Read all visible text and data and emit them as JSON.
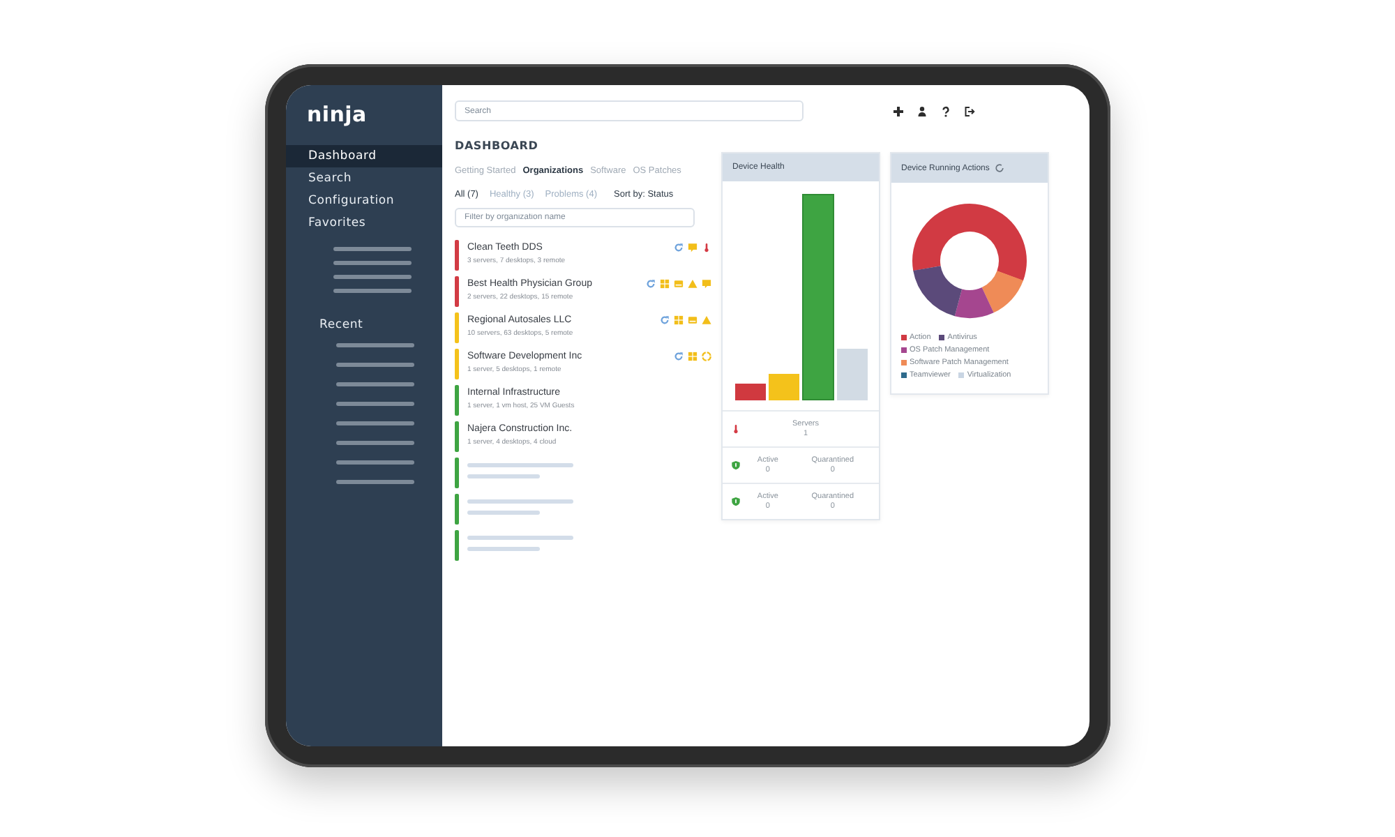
{
  "sidebar": {
    "logo": "ninja",
    "items": [
      {
        "label": "Dashboard",
        "selected": true
      },
      {
        "label": "Search",
        "selected": false
      },
      {
        "label": "Configuration",
        "selected": false
      },
      {
        "label": "Favorites",
        "selected": false
      }
    ],
    "recent_label": "Recent"
  },
  "top_bar": {
    "search": {
      "placeholder": "Search"
    }
  },
  "dashboard": {
    "title": "DASHBOARD",
    "tabs": [
      {
        "label": "Getting Started",
        "selected": false
      },
      {
        "label": "Organizations",
        "selected": true
      },
      {
        "label": "Software",
        "selected": false
      },
      {
        "label": "OS Patches",
        "selected": false
      }
    ],
    "filters": [
      {
        "label": "All (7)",
        "selected": true
      },
      {
        "label": "Healthy (3)",
        "selected": false
      },
      {
        "label": "Problems (4)",
        "selected": false
      }
    ],
    "sort_label": "Sort by: Status",
    "filter_field": {
      "placeholder": "Filter by organization name"
    },
    "organizations": [
      {
        "kind": "org",
        "name": "Clean Teeth DDS",
        "details": "3 servers, 7 desktops, 3 remote",
        "color": "#d23b44",
        "alerts": [
          {
            "kind": "sync"
          },
          {
            "kind": "bubble"
          },
          {
            "kind": "temperature"
          }
        ]
      },
      {
        "kind": "org",
        "name": "Best Health Physician Group",
        "details": "2 servers, 22 desktops, 15 remote",
        "color": "#d23b44",
        "alerts": [
          {
            "kind": "sync"
          },
          {
            "kind": "squares"
          },
          {
            "kind": "drive"
          },
          {
            "kind": "warning"
          },
          {
            "kind": "bubble"
          }
        ]
      },
      {
        "kind": "org",
        "name": "Regional Autosales LLC",
        "details": "10 servers, 63 desktops, 5 remote",
        "color": "#f4c21b",
        "alerts": [
          {
            "kind": "sync"
          },
          {
            "kind": "squares"
          },
          {
            "kind": "drive"
          },
          {
            "kind": "warning"
          }
        ]
      },
      {
        "kind": "org",
        "name": "Software Development Inc",
        "details": "1 server, 5 desktops, 1 remote",
        "color": "#f4c21b",
        "alerts": [
          {
            "kind": "sync"
          },
          {
            "kind": "squares"
          },
          {
            "kind": "ring"
          }
        ]
      },
      {
        "kind": "org",
        "name": "Internal Infrastructure",
        "details": "1 server, 1 vm host, 25 VM Guests",
        "color": "#3ea442"
      },
      {
        "kind": "org",
        "name": "Najera Construction Inc.",
        "details": "1 server, 4 desktops, 4 cloud",
        "color": "#3ea442"
      },
      {
        "kind": "placeholder",
        "color": "#3ea442"
      },
      {
        "kind": "placeholder",
        "color": "#3ea442"
      },
      {
        "kind": "placeholder",
        "color": "#3ea442"
      }
    ]
  },
  "device_health": {
    "title": "Device Health",
    "stats": [
      {
        "kind": "temperature",
        "cells": [
          {
            "label": "Servers",
            "value": "1"
          }
        ]
      },
      {
        "kind": "shield",
        "cells": [
          {
            "label": "Active",
            "value": "0"
          },
          {
            "label": "Quarantined",
            "value": "0"
          }
        ]
      },
      {
        "kind": "shield",
        "cells": [
          {
            "label": "Active",
            "value": "0"
          },
          {
            "label": "Quarantined",
            "value": "0"
          }
        ]
      }
    ]
  },
  "device_running_actions": {
    "title": "Device Running Actions",
    "legend": [
      {
        "label": "Action",
        "color": "#d13a43"
      },
      {
        "label": "Antivirus",
        "color": "#5b4a7a"
      },
      {
        "label": "OS Patch Management",
        "color": "#a5468f"
      },
      {
        "label": "Software Patch Management",
        "color": "#ef8b57"
      },
      {
        "label": "Teamviewer",
        "color": "#2f6b8c"
      },
      {
        "label": "Virtualization",
        "color": "#c9d5e3"
      }
    ]
  }
}
